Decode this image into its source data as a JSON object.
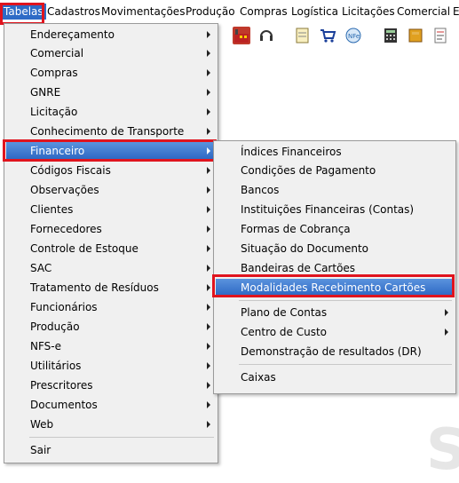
{
  "menubar": {
    "items": [
      "Tabelas",
      "Cadastros",
      "Movimentações",
      "Produção",
      "Compras",
      "Logística",
      "Licitações",
      "Comercial",
      "E"
    ]
  },
  "menu1": {
    "items": [
      "Endereçamento",
      "Comercial",
      "Compras",
      "GNRE",
      "Licitação",
      "Conhecimento de Transporte",
      "Financeiro",
      "Códigos Fiscais",
      "Observações",
      "Clientes",
      "Fornecedores",
      "Controle de Estoque",
      "SAC",
      "Tratamento de Resíduos",
      "Funcionários",
      "Produção",
      "NFS-e",
      "Utilitários",
      "Prescritores",
      "Documentos",
      "Web",
      "Sair"
    ]
  },
  "menu2": {
    "items": [
      "Índices Financeiros",
      "Condições de Pagamento",
      "Bancos",
      "Instituições Financeiras (Contas)",
      "Formas de Cobrança",
      "Situação do Documento",
      "Bandeiras de Cartões",
      "Modalidades Recebimento Cartões",
      "Plano de Contas",
      "Centro de Custo",
      "Demonstração de resultados (DR)",
      "Caixas"
    ]
  },
  "colors": {
    "highlight": "#2e6bc6",
    "callout": "#e0141e",
    "menu_bg": "#f0f0f0"
  },
  "icons": [
    "factory-icon",
    "headset-icon",
    "notepad-icon",
    "cart-icon",
    "nfe-icon",
    "calculator-icon",
    "notebook-icon",
    "form-icon"
  ]
}
